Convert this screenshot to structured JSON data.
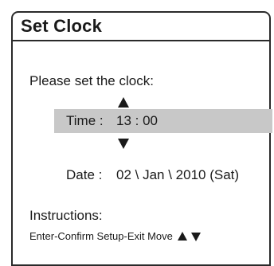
{
  "dialog": {
    "title": "Set Clock",
    "prompt": "Please set the clock:",
    "time": {
      "label": "Time :",
      "value": "13 : 00"
    },
    "date": {
      "label": "Date :",
      "value": "02 \\ Jan \\ 2010  (Sat)"
    },
    "instructions": {
      "label": "Instructions:",
      "text": "Enter-Confirm  Setup-Exit  Move"
    },
    "icons": {
      "increase": "up-arrow-icon",
      "decrease": "down-arrow-icon"
    },
    "colors": {
      "selected_row": "#c8c8c8",
      "border": "#2a2a2a"
    }
  }
}
